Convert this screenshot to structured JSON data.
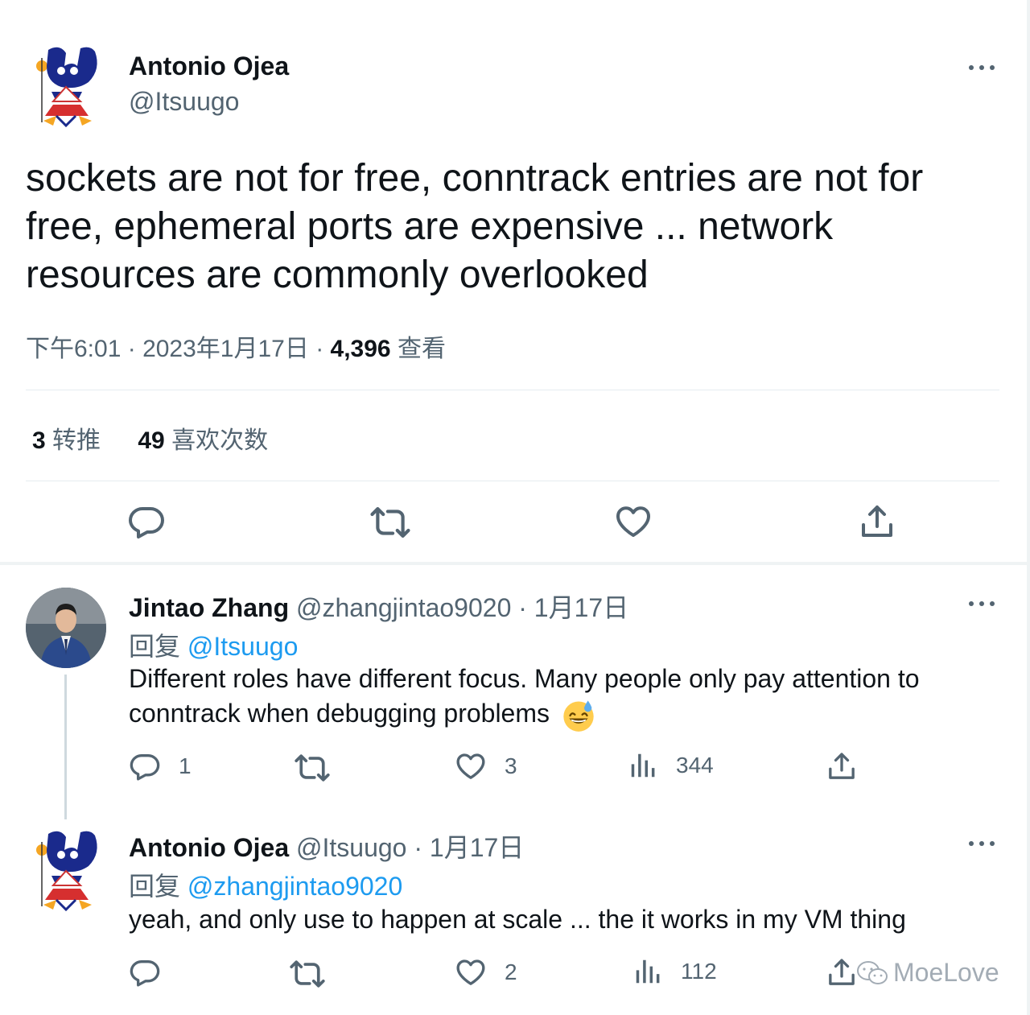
{
  "main_tweet": {
    "author_name": "Antonio Ojea",
    "author_handle": "@Itsuugo",
    "text": "sockets are not for free, conntrack entries are not for free, ephemeral ports are expensive ... network resources are commonly overlooked",
    "time": "下午6:01",
    "separator": " · ",
    "date": "2023年1月17日",
    "views_count": "4,396",
    "views_label": " 查看",
    "retweets_count": "3",
    "retweets_label": " 转推",
    "likes_count": "49",
    "likes_label": " 喜欢次数",
    "icons": [
      "more-icon",
      "reply-icon",
      "retweet-icon",
      "like-icon",
      "share-icon"
    ]
  },
  "replies": [
    {
      "author_name": "Jintao Zhang",
      "author_handle": "@zhangjintao9020",
      "date": "· 1月17日",
      "reply_prefix": "回复 ",
      "reply_to": "@Itsuugo",
      "text": "Different roles have different focus. Many people only pay attention to conntrack when debugging problems",
      "emoji": "grinning-sweat-emoji",
      "reply_count": "1",
      "retweet_count": "",
      "like_count": "3",
      "view_count": "344"
    },
    {
      "author_name": "Antonio Ojea",
      "author_handle": "@Itsuugo",
      "date": "· 1月17日",
      "reply_prefix": "回复 ",
      "reply_to": "@zhangjintao9020",
      "text": "yeah, and only use to happen at scale ... the it works in my VM thing",
      "reply_count": "",
      "retweet_count": "",
      "like_count": "2",
      "view_count": "112"
    }
  ],
  "watermark": "MoeLove",
  "colors": {
    "text": "#0f1419",
    "muted": "#536471",
    "link": "#1d9bf0",
    "divider": "#e6ecf0"
  }
}
